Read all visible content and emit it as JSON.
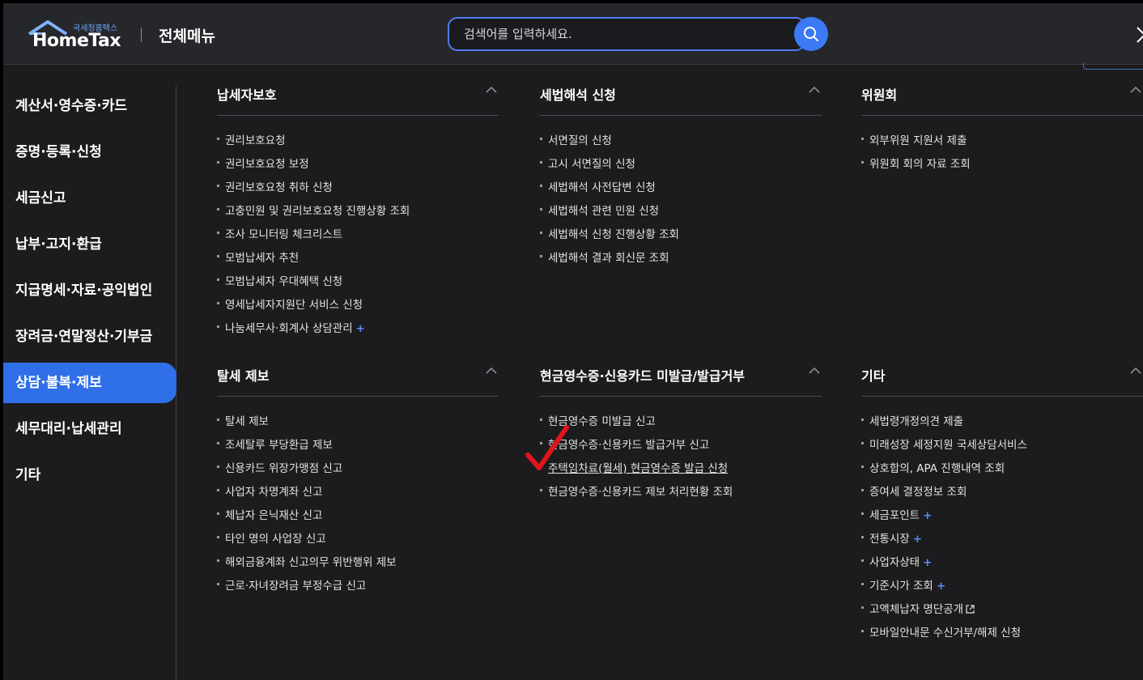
{
  "header": {
    "logo_sub": "국세청홈택스",
    "logo_main": "HomeTax",
    "title": "전체메뉴",
    "search_placeholder": "검색어를 입력하세요."
  },
  "sidebar": {
    "items": [
      {
        "label": "계산서·영수증·카드",
        "active": false
      },
      {
        "label": "증명·등록·신청",
        "active": false
      },
      {
        "label": "세금신고",
        "active": false
      },
      {
        "label": "납부·고지·환급",
        "active": false
      },
      {
        "label": "지급명세·자료·공익법인",
        "active": false
      },
      {
        "label": "장려금·연말정산·기부금",
        "active": false
      },
      {
        "label": "상담·불복·제보",
        "active": true
      },
      {
        "label": "세무대리·납세관리",
        "active": false
      },
      {
        "label": "기타",
        "active": false
      }
    ]
  },
  "sections": [
    {
      "title": "납세자보호",
      "items": [
        {
          "label": "권리보호요청"
        },
        {
          "label": "권리보호요청 보정"
        },
        {
          "label": "권리보호요청 취하 신청"
        },
        {
          "label": "고충민원 및 권리보호요청 진행상황 조회"
        },
        {
          "label": "조사 모니터링 체크리스트"
        },
        {
          "label": "모범납세자 추천"
        },
        {
          "label": "모범납세자 우대혜택 신청"
        },
        {
          "label": "영세납세자지원단 서비스 신청"
        },
        {
          "label": "나눔세무사·회계사 상담관리",
          "plus": "+"
        }
      ]
    },
    {
      "title": "세법해석 신청",
      "items": [
        {
          "label": "서면질의 신청"
        },
        {
          "label": "고시 서면질의 신청"
        },
        {
          "label": "세법해석 사전답변 신청"
        },
        {
          "label": "세법해석 관련 민원 신청"
        },
        {
          "label": "세법해석 신청 진행상황 조회"
        },
        {
          "label": "세법해석 결과 회신문 조회"
        }
      ]
    },
    {
      "title": "위원회",
      "items": [
        {
          "label": "외부위원 지원서 제출"
        },
        {
          "label": "위원회 회의 자료 조회"
        }
      ]
    },
    {
      "title": "탈세 제보",
      "items": [
        {
          "label": "탈세 제보"
        },
        {
          "label": "조세탈루 부당환급 제보"
        },
        {
          "label": "신용카드 위장가맹점 신고"
        },
        {
          "label": "사업자 차명계좌 신고"
        },
        {
          "label": "체납자 은닉재산 신고"
        },
        {
          "label": "타인 명의 사업장 신고"
        },
        {
          "label": "해외금융계좌 신고의무 위반행위 제보"
        },
        {
          "label": "근로·자녀장려금 부정수급 신고"
        }
      ]
    },
    {
      "title": "현금영수증·신용카드 미발급/발급거부",
      "items": [
        {
          "label": "현금영수증 미발급 신고"
        },
        {
          "label": "현금영수증·신용카드 발급거부 신고"
        },
        {
          "label": "주택임차료(월세) 현금영수증 발급 신청"
        },
        {
          "label": "현금영수증·신용카드 제보 처리현황 조회"
        }
      ]
    },
    {
      "title": "기타",
      "items": [
        {
          "label": "세법령개정의견 제출"
        },
        {
          "label": "미래성장 세정지원 국세상담서비스"
        },
        {
          "label": "상호합의, APA 진행내역 조회"
        },
        {
          "label": "증여세 결정정보 조회"
        },
        {
          "label": "세금포인트",
          "plus": "+"
        },
        {
          "label": "전통시장",
          "plus": "+"
        },
        {
          "label": "사업자상태",
          "plus": "+"
        },
        {
          "label": "기준시가 조회",
          "plus": "+"
        },
        {
          "label": "고액체납자 명단공개",
          "external": "external-link-icon"
        },
        {
          "label": "모바일안내문 수신거부/해제 신청"
        }
      ]
    }
  ],
  "colors": {
    "accent": "#2f6fe8",
    "plus": "#5b8dff",
    "checkmark": "#e0151b",
    "background": "#1c1c1e"
  }
}
